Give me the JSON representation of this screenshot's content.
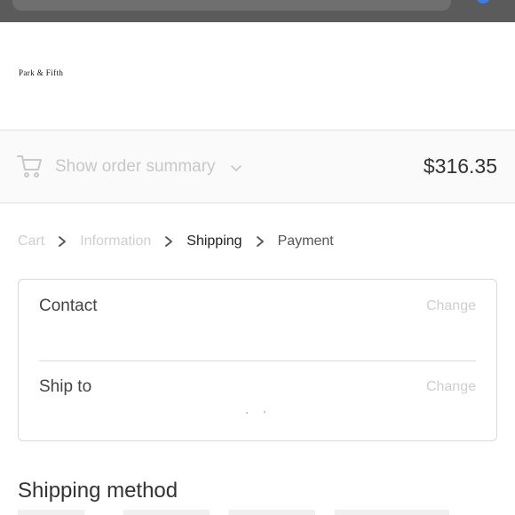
{
  "header": {
    "logo_text": "Park & Fifth"
  },
  "summary": {
    "toggle_label": "Show order summary",
    "total": "$316.35",
    "icons": [
      "cart-icon",
      "chevron-down-icon"
    ]
  },
  "breadcrumb": {
    "items": [
      "Cart",
      "Information",
      "Shipping",
      "Payment"
    ],
    "separator_icon": "chevron-right-icon"
  },
  "review": {
    "contact_label": "Contact",
    "contact_change": "Change",
    "ship_to_label": "Ship to",
    "ship_to_change": "Change"
  },
  "shipping_method": {
    "heading": "Shipping method"
  },
  "colors": {
    "muted_text": "#cfcfcf",
    "border": "#d9d9d9",
    "summary_bg": "#fafafa",
    "browser_chrome": "#5b5b5b"
  }
}
